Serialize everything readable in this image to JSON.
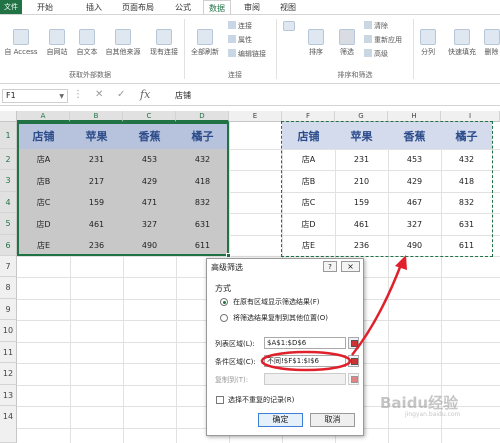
{
  "ribbon": {
    "file_tab": "文件",
    "tabs": [
      "开始",
      "插入",
      "页面布局",
      "公式",
      "数据",
      "审阅",
      "视图"
    ],
    "active_tab": "数据",
    "buttons": {
      "from_access": "自 Access",
      "from_web": "自网站",
      "from_text": "自文本",
      "from_other": "自其他来源",
      "existing": "现有连接",
      "refresh_all": "全部刷新",
      "connections": "连接",
      "properties": "属性",
      "edit_links": "编辑链接",
      "sort": "排序",
      "filter": "筛选",
      "clear": "清除",
      "reapply": "重新应用",
      "advanced": "高级",
      "split": "分列",
      "flash_fill": "快速填充",
      "remove_dup": "删除"
    },
    "groups": {
      "external": "获取外部数据",
      "connections": "连接",
      "sort_filter": "排序和筛选"
    }
  },
  "formula_bar": {
    "name_box": "F1",
    "formula": "店铺"
  },
  "columns": [
    "A",
    "B",
    "C",
    "D",
    "E",
    "F",
    "G",
    "H",
    "I"
  ],
  "rows": [
    "1",
    "2",
    "3",
    "4",
    "5",
    "6",
    "7",
    "8",
    "9",
    "10",
    "11",
    "12",
    "13",
    "14"
  ],
  "left_table": {
    "headers": [
      "店铺",
      "苹果",
      "香蕉",
      "橘子"
    ],
    "rows": [
      [
        "店A",
        "231",
        "453",
        "432"
      ],
      [
        "店B",
        "217",
        "429",
        "418"
      ],
      [
        "店C",
        "159",
        "471",
        "832"
      ],
      [
        "店D",
        "461",
        "327",
        "631"
      ],
      [
        "店E",
        "236",
        "490",
        "611"
      ]
    ]
  },
  "right_table": {
    "headers": [
      "店铺",
      "苹果",
      "香蕉",
      "橘子"
    ],
    "rows": [
      [
        "店A",
        "231",
        "453",
        "432"
      ],
      [
        "店B",
        "210",
        "429",
        "418"
      ],
      [
        "店C",
        "159",
        "467",
        "832"
      ],
      [
        "店D",
        "461",
        "327",
        "631"
      ],
      [
        "店E",
        "236",
        "490",
        "611"
      ]
    ]
  },
  "dialog": {
    "title": "高级筛选",
    "help": "?",
    "close": "×",
    "method_label": "方式",
    "radio1": "在原有区域显示筛选结果(F)",
    "radio2": "将筛选结果复制到其他位置(O)",
    "list_range_label": "列表区域(L):",
    "list_range_value": "$A$1:$D$6",
    "criteria_label": "条件区域(C):",
    "criteria_value": "不同!$F$1:$I$6",
    "copy_to_label": "复制到(T):",
    "copy_to_value": "",
    "unique_label": "选择不重复的记录(R)",
    "ok": "确定",
    "cancel": "取消"
  },
  "watermark": {
    "text": "Baidu经验",
    "sub": "jingyan.baidu.com"
  },
  "colors": {
    "excel_green": "#217346",
    "arrow_red": "#e0202a",
    "header_text": "#2c4b8a"
  }
}
